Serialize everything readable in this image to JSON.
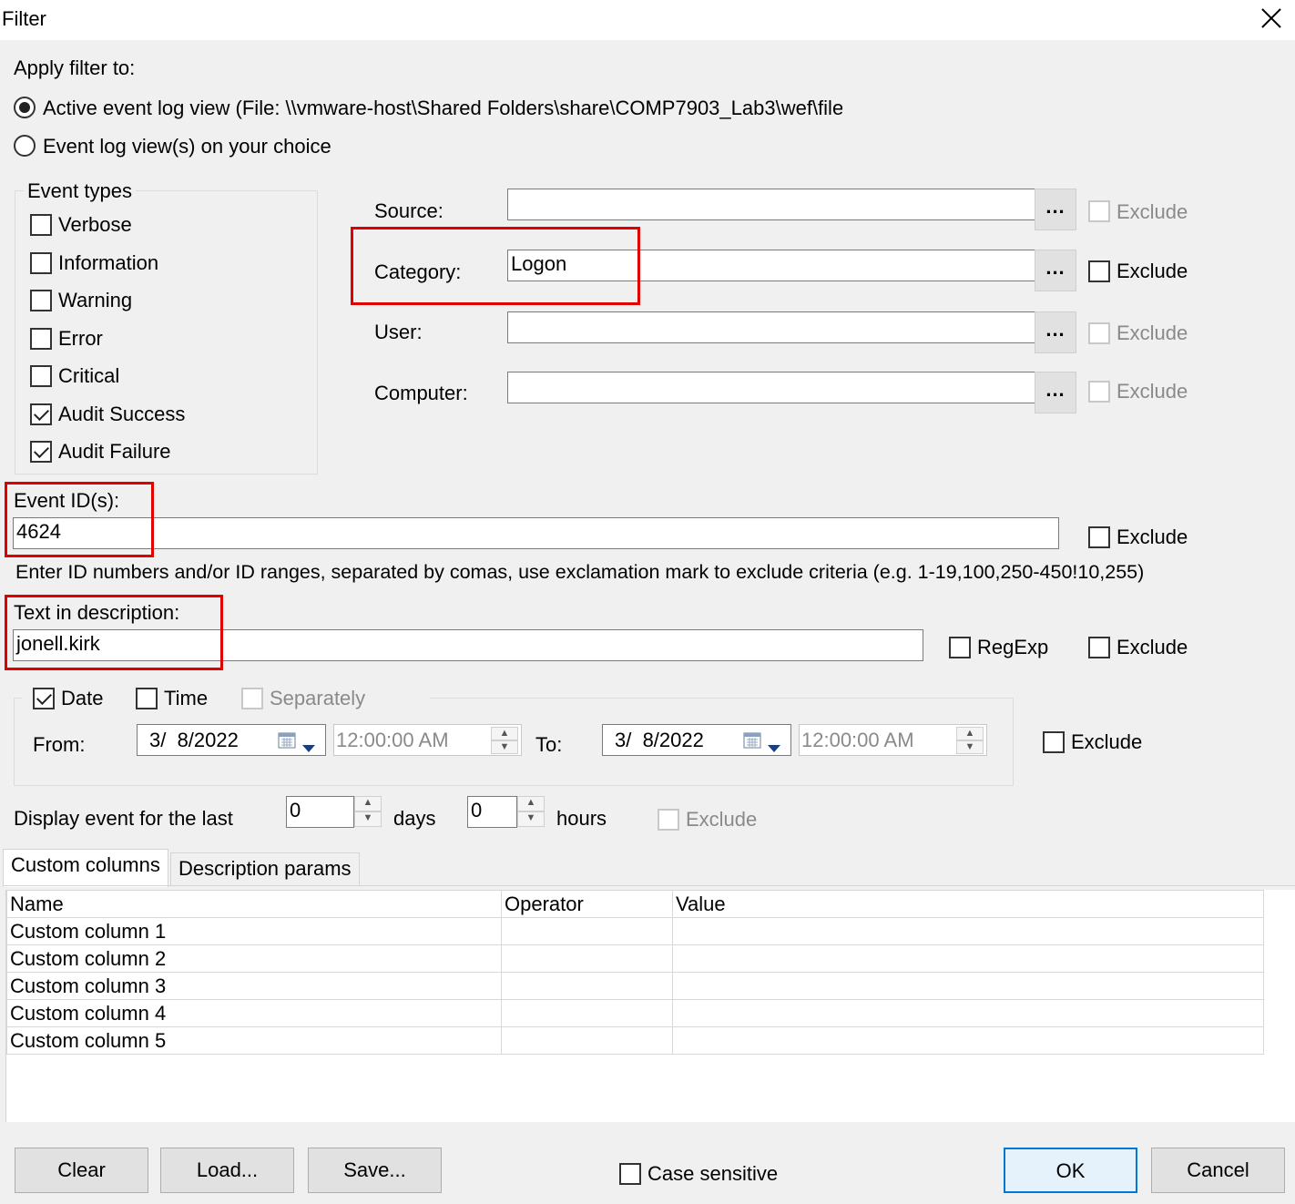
{
  "window": {
    "title": "Filter"
  },
  "apply_filter": {
    "label": "Apply filter to:",
    "option_active": "Active event log view (File: \\\\vmware-host\\Shared Folders\\share\\COMP7903_Lab3\\wef\\file",
    "option_choice": "Event log view(s) on your choice",
    "selected": "active"
  },
  "event_types": {
    "title": "Event types",
    "items": [
      {
        "label": "Verbose",
        "checked": false
      },
      {
        "label": "Information",
        "checked": false
      },
      {
        "label": "Warning",
        "checked": false
      },
      {
        "label": "Error",
        "checked": false
      },
      {
        "label": "Critical",
        "checked": false
      },
      {
        "label": "Audit Success",
        "checked": true
      },
      {
        "label": "Audit Failure",
        "checked": true
      }
    ]
  },
  "fields": {
    "source": {
      "label": "Source:",
      "value": "",
      "exclude": "Exclude",
      "exclude_enabled": false
    },
    "category": {
      "label": "Category:",
      "value": "Logon",
      "exclude": "Exclude",
      "exclude_enabled": true
    },
    "user": {
      "label": "User:",
      "value": "",
      "exclude": "Exclude",
      "exclude_enabled": false
    },
    "computer": {
      "label": "Computer:",
      "value": "",
      "exclude": "Exclude",
      "exclude_enabled": false
    },
    "browse_label": "..."
  },
  "event_ids": {
    "label": "Event ID(s):",
    "value": "4624",
    "exclude": "Exclude",
    "hint": "Enter ID numbers and/or ID ranges, separated by comas, use exclamation mark to exclude criteria (e.g. 1-19,100,250-450!10,255)"
  },
  "description": {
    "label": "Text in description:",
    "value": "jonell.kirk",
    "regexp": "RegExp",
    "exclude": "Exclude"
  },
  "datetime": {
    "date_label": "Date",
    "date_checked": true,
    "time_label": "Time",
    "time_checked": false,
    "separately_label": "Separately",
    "from_label": "From:",
    "from_date": "3/  8/2022",
    "from_time": "12:00:00 AM",
    "to_label": "To:",
    "to_date": "3/  8/2022",
    "to_time": "12:00:00 AM",
    "exclude": "Exclude"
  },
  "last": {
    "label": "Display event for the last",
    "days_value": "0",
    "days_label": "days",
    "hours_value": "0",
    "hours_label": "hours",
    "exclude": "Exclude"
  },
  "tabs": [
    {
      "label": "Custom columns",
      "active": true
    },
    {
      "label": "Description params",
      "active": false
    }
  ],
  "custom_table": {
    "headers": [
      "Name",
      "Operator",
      "Value"
    ],
    "rows": [
      [
        "Custom column 1",
        "",
        ""
      ],
      [
        "Custom column 2",
        "",
        ""
      ],
      [
        "Custom column 3",
        "",
        ""
      ],
      [
        "Custom column 4",
        "",
        ""
      ],
      [
        "Custom column 5",
        "",
        ""
      ]
    ]
  },
  "footer": {
    "clear": "Clear",
    "load": "Load...",
    "save": "Save...",
    "case_sensitive": "Case sensitive",
    "ok": "OK",
    "cancel": "Cancel"
  },
  "colors": {
    "highlight_box": "#e00000",
    "dialog_bg": "#f0f0f0",
    "default_button_border": "#0078d7"
  },
  "icons": {
    "close": "close-icon",
    "calendar": "calendar-icon",
    "dropdown": "chevron-down-icon",
    "spin_up": "spin-up-icon",
    "spin_down": "spin-down-icon"
  }
}
